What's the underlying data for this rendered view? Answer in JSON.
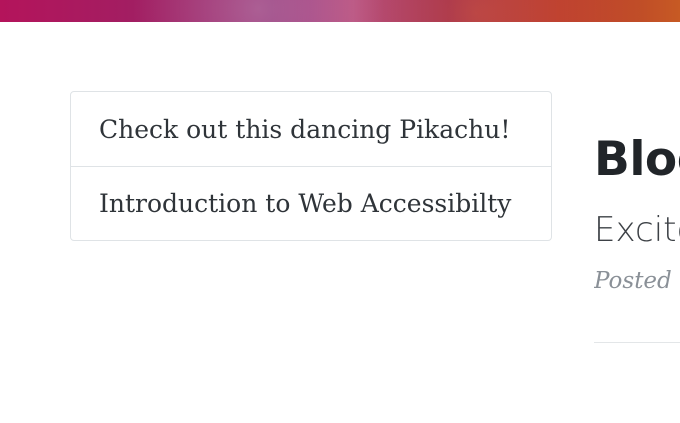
{
  "header": {
    "hero_background": [
      "#b4145b",
      "#8e2a72",
      "#c75a24"
    ]
  },
  "posts_nav": {
    "items": [
      {
        "label": "Check out this dancing Pikachu!"
      },
      {
        "label": "Introduction to Web Accessibilty"
      }
    ]
  },
  "post_preview": {
    "title": "Blog",
    "subtitle": "Excite",
    "meta": "Posted b"
  },
  "colors": {
    "text_dark": "#212529",
    "text_muted": "#8a9097",
    "border": "#dfe3e6"
  }
}
